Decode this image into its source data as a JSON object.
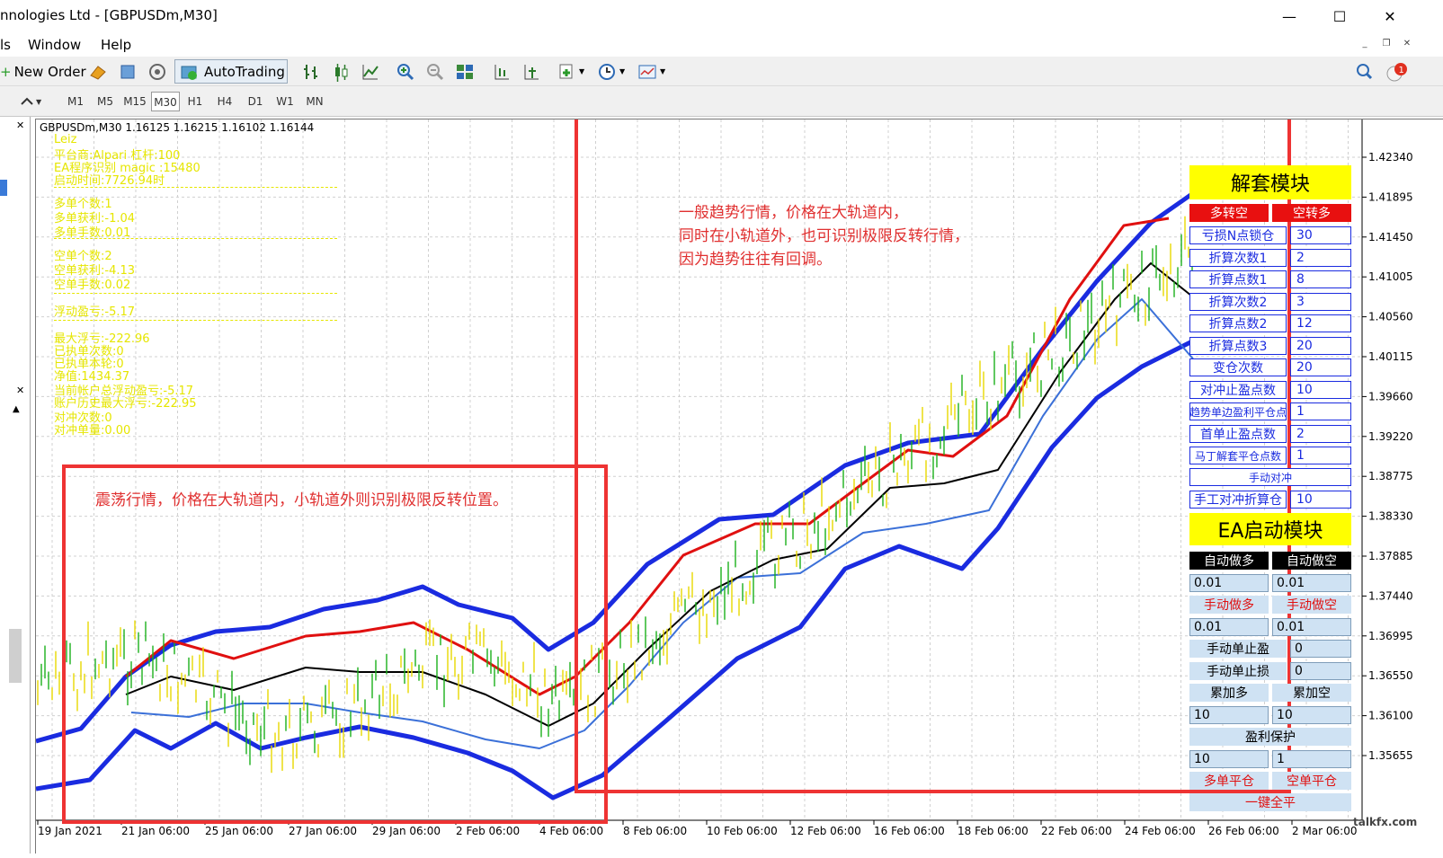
{
  "window": {
    "title": "nnologies Ltd - [GBPUSDm,M30]"
  },
  "menu": [
    "ls",
    "Window",
    "Help"
  ],
  "toolbar": {
    "new_order": "New Order",
    "autotrading": "AutoTrading"
  },
  "timeframes": [
    "M1",
    "M5",
    "M15",
    "M30",
    "H1",
    "H4",
    "D1",
    "W1",
    "MN"
  ],
  "active_timeframe": "M30",
  "chart": {
    "header": "GBPUSDm,M30  1.16125 1.16215 1.16102 1.16144",
    "price_labels": [
      "1.42340",
      "1.41895",
      "1.41450",
      "1.41005",
      "1.40560",
      "1.40115",
      "1.39660",
      "1.39220",
      "1.38775",
      "1.38330",
      "1.37885",
      "1.37440",
      "1.36995",
      "1.36550",
      "1.36100",
      "1.35655"
    ],
    "time_labels": [
      "19 Jan 2021",
      "21 Jan 06:00",
      "25 Jan 06:00",
      "27 Jan 06:00",
      "29 Jan 06:00",
      "2 Feb 06:00",
      "4 Feb 06:00",
      "8 Feb 06:00",
      "10 Feb 06:00",
      "12 Feb 06:00",
      "16 Feb 06:00",
      "18 Feb 06:00",
      "22 Feb 06:00",
      "24 Feb 06:00",
      "26 Feb 06:00",
      "2 Mar 06:00"
    ],
    "watermark": "talkfx.com"
  },
  "info_lines": [
    "Leiz",
    "平台商:Alpari 杠杆:100",
    "EA程序识别 magic :15480",
    "启动时间:7726.94时",
    "多单个数:1",
    "多单获利:-1.04",
    "多单手数:0.01",
    "空单个数:2",
    "空单获利:-4.13",
    "空单手数:0.02",
    "浮动盈亏:-5.17",
    "最大浮亏:-222.96",
    "已执单次数:0",
    "已执单本轮:0",
    "净值:1434.37",
    "当前帐户总浮动盈亏:-5.17",
    "账户历史最大浮亏:-222.95",
    "对冲次数:0",
    "对冲单量:0.00"
  ],
  "annotations": {
    "trend": [
      "一般趋势行情，价格在大轨道内，",
      "同时在小轨道外，也可识别极限反转行情，",
      "因为趋势往往有回调。"
    ],
    "range": "震荡行情，价格在大轨道内，小轨道外则识别极限反转位置。"
  },
  "panel": {
    "title1": "解套模块",
    "long_to_short": "多转空",
    "short_to_long": "空转多",
    "rows": [
      {
        "label": "亏损N点锁仓",
        "value": "30"
      },
      {
        "label": "折算次数1",
        "value": "2"
      },
      {
        "label": "折算点数1",
        "value": "8"
      },
      {
        "label": "折算次数2",
        "value": "3"
      },
      {
        "label": "折算点数2",
        "value": "12"
      },
      {
        "label": "折算点数3",
        "value": "20"
      },
      {
        "label": "变仓次数",
        "value": "20"
      },
      {
        "label": "对冲止盈点数",
        "value": "10"
      },
      {
        "label": "趋势单边盈利平仓点",
        "value": "1"
      },
      {
        "label": "首单止盈点数",
        "value": "2"
      },
      {
        "label": "马丁解套平仓点数",
        "value": "1"
      }
    ],
    "manual_hedge": "手动对冲",
    "manual_hedge_calc": {
      "label": "手工对冲折算仓",
      "value": "10"
    },
    "title2": "EA启动模块",
    "auto_long": "自动做多",
    "auto_short": "自动做空",
    "lot1": "0.01",
    "lot2": "0.01",
    "manual_long": "手动做多",
    "manual_short": "手动做空",
    "lot3": "0.01",
    "lot4": "0.01",
    "manual_tp": {
      "label": "手动单止盈",
      "value": "0"
    },
    "manual_sl": {
      "label": "手动单止损",
      "value": "0"
    },
    "add_long": "累加多",
    "add_short": "累加空",
    "add_long_val": "10",
    "add_short_val": "10",
    "profit_protect": "盈利保护",
    "pp_val1": "10",
    "pp_val2": "1",
    "close_long": "多单平仓",
    "close_short": "空单平仓",
    "close_all": "一键全平"
  },
  "colors": {
    "upper_band": "#1a2be0",
    "lower_band": "#1a2be0",
    "inner_upper": "#e01010",
    "inner_lower": "#3b70d8",
    "mid": "#000000",
    "annotation": "#ee3333",
    "info": "#e6e600"
  }
}
